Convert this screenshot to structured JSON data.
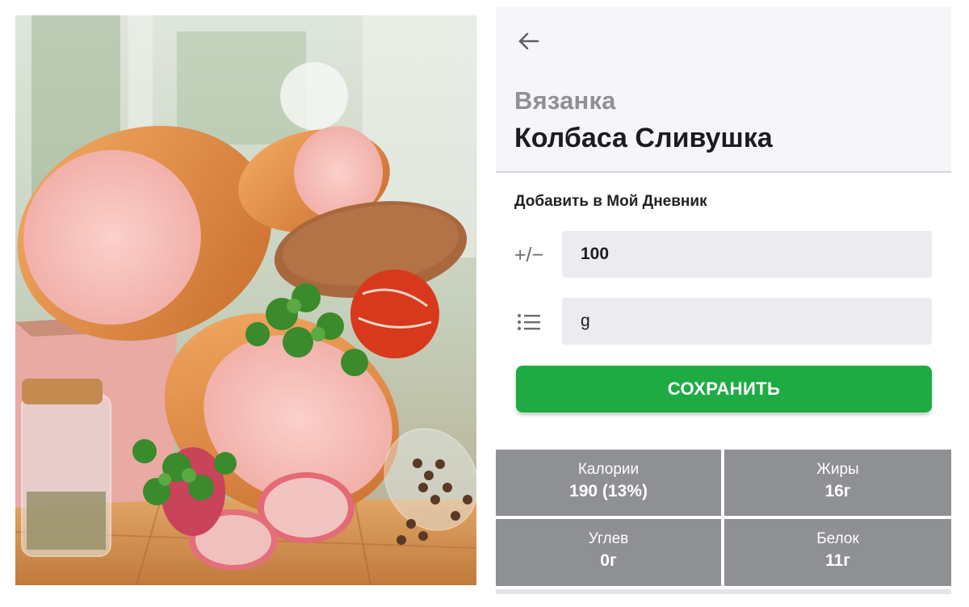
{
  "product": {
    "brand": "Вязанка",
    "name": "Колбаса Сливушка"
  },
  "diary": {
    "title": "Добавить в Мой Дневник",
    "quantity_icon": "+/−",
    "quantity_value": "100",
    "unit_value": "g",
    "save_label": "СОХРАНИТЬ"
  },
  "nutrition": [
    {
      "label": "Калории",
      "value": "190 (13%)"
    },
    {
      "label": "Жиры",
      "value": "16г"
    },
    {
      "label": "Углев",
      "value": "0г"
    },
    {
      "label": "Белок",
      "value": "11г"
    }
  ],
  "icons": {
    "back": "arrow-left-icon",
    "quantity": "plus-minus-icon",
    "unit": "list-icon"
  },
  "colors": {
    "accent_green": "#1fab44",
    "header_bg": "#f6f6fa",
    "field_bg": "#ebebf0",
    "nutrition_bg": "#8e9094"
  }
}
